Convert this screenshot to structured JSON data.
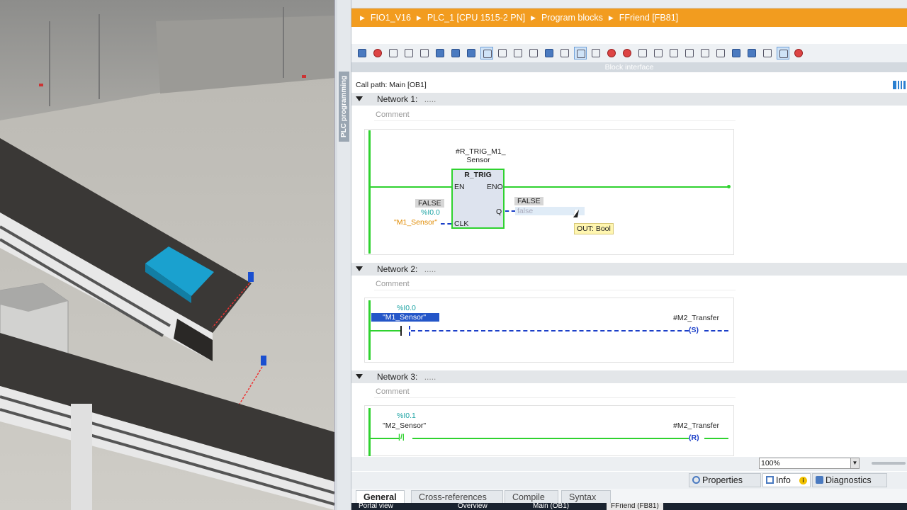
{
  "breadcrumb": {
    "items": [
      "FIO1_V16",
      "PLC_1 [CPU 1515-2 PN]",
      "Program blocks",
      "FFriend [FB81]"
    ]
  },
  "side_tab": "PLC programming",
  "block_interface": "Block interface",
  "call_path": "Call path: Main [OB1]",
  "networks": [
    {
      "title": "Network 1:",
      "dots": ".....",
      "comment": "Comment",
      "instance_line1": "#R_TRIG_M1_",
      "instance_line2": "Sensor",
      "box_title": "R_TRIG",
      "pin_en": "EN",
      "pin_eno": "ENO",
      "pin_q": "Q",
      "pin_clk": "CLK",
      "clk_value": "FALSE",
      "clk_addr": "%I0.0",
      "clk_tag": "\"M1_Sensor\"",
      "q_value": "FALSE",
      "q_input": "false",
      "tooltip": "OUT: Bool"
    },
    {
      "title": "Network 2:",
      "dots": ".....",
      "comment": "Comment",
      "contact_addr": "%I0.0",
      "contact_tag": "\"M1_Sensor\"",
      "coil_tag": "#M2_Transfer",
      "coil_label": "S"
    },
    {
      "title": "Network 3:",
      "dots": ".....",
      "comment": "Comment",
      "contact_addr": "%I0.1",
      "contact_tag": "\"M2_Sensor\"",
      "coil_tag": "#M2_Transfer",
      "coil_label": "R"
    }
  ],
  "zoom": "100%",
  "panel_tabs": [
    "Properties",
    "Info",
    "Diagnostics"
  ],
  "bottom_tabs": [
    "General",
    "Cross-references",
    "Compile",
    "Syntax"
  ],
  "taskbar": [
    "Portal view",
    "Overview",
    "Main (OB1)",
    "FFriend (FB81)"
  ],
  "colors": {
    "accent": "#f29c1f",
    "rung_green": "#2fd22f",
    "selected_blue": "#2456c8",
    "box_fill": "#dde3ee"
  }
}
